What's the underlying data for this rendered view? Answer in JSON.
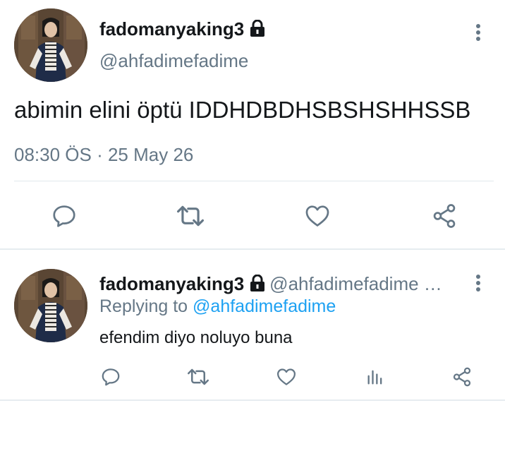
{
  "main_tweet": {
    "display_name": "fadomanyaking3",
    "handle": "@ahfadimefadime",
    "text": "abimin elini öptü IDDHDBDHSBSHSHHSSB",
    "timestamp": "08:30 ÖS · 25 May 26",
    "icons": [
      "lock-icon",
      "more-vertical-icon",
      "reply-icon",
      "retweet-icon",
      "like-icon",
      "share-icon"
    ]
  },
  "reply_tweet": {
    "display_name": "fadomanyaking3",
    "handle": "@ahfadimefadime …",
    "replying_prefix": "Replying to ",
    "replying_to": "@ahfadimefadime",
    "text": "efendim diyo noluyo buna",
    "icons": [
      "lock-icon",
      "more-vertical-icon",
      "reply-icon",
      "retweet-icon",
      "like-icon",
      "analytics-icon",
      "share-icon"
    ]
  },
  "colors": {
    "primary_text": "#14171a",
    "secondary_text": "#657786",
    "link": "#1da1f2",
    "divider": "#e1e8ed"
  }
}
